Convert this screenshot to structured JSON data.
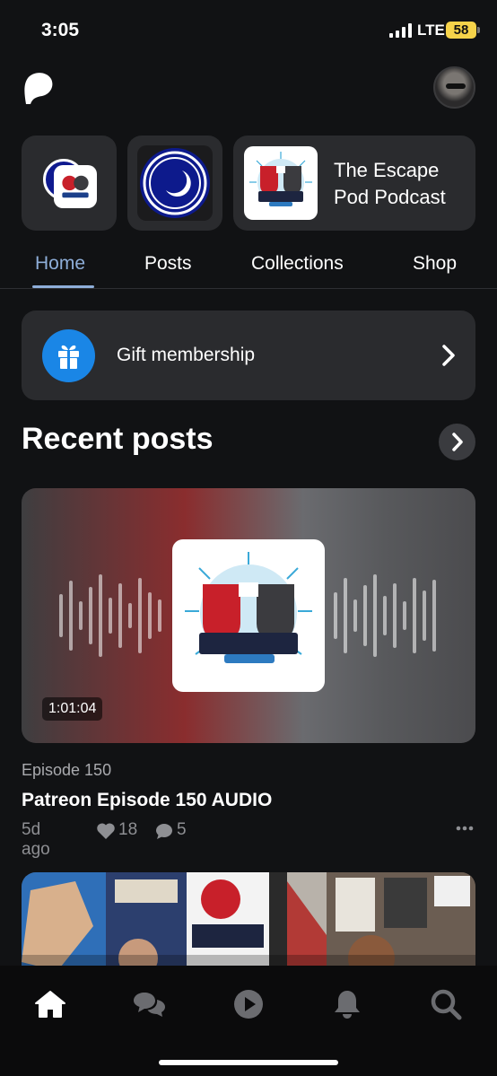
{
  "status_bar": {
    "time": "3:05",
    "network": "LTE",
    "battery": "58"
  },
  "creators": [
    {
      "name": ""
    },
    {
      "name": ""
    },
    {
      "name": "The Escape Pod Podcast"
    }
  ],
  "tabs": [
    {
      "label": "Home",
      "active": true
    },
    {
      "label": "Posts"
    },
    {
      "label": "Collections"
    },
    {
      "label": "Shop"
    }
  ],
  "gift": {
    "label": "Gift membership"
  },
  "recent_posts": {
    "title": "Recent posts",
    "posts": [
      {
        "duration": "1:01:04",
        "episode": "Episode 150",
        "title": "Patreon Episode 150 AUDIO",
        "age": "5d ago",
        "likes": "18",
        "comments": "5"
      }
    ]
  },
  "colors": {
    "accent": "#8eaed9",
    "gift_icon": "#1a86e6",
    "card": "#2a2b2e",
    "background": "#111214"
  },
  "bottom_nav": [
    "home-icon",
    "chat-icon",
    "play-icon",
    "bell-icon",
    "search-icon"
  ]
}
